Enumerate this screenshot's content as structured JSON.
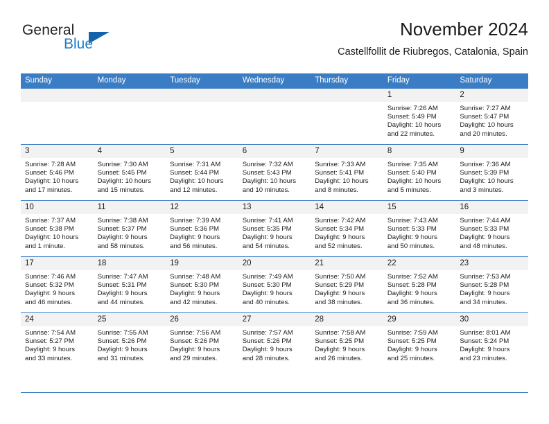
{
  "brand": {
    "name_part1": "General",
    "name_part2": "Blue",
    "triangle_color": "#1164ac",
    "blue_color": "#1d7dc4"
  },
  "header": {
    "title": "November 2024",
    "subtitle": "Castellfollit de Riubregos, Catalonia, Spain"
  },
  "theme": {
    "header_bg": "#3b7dc4",
    "daynum_bg": "#f2f2f2",
    "grid_line": "#3b7dc4"
  },
  "weekday_headers": [
    "Sunday",
    "Monday",
    "Tuesday",
    "Wednesday",
    "Thursday",
    "Friday",
    "Saturday"
  ],
  "weeks": [
    [
      {
        "day": "",
        "sunrise": "",
        "sunset": "",
        "daylight1": "",
        "daylight2": ""
      },
      {
        "day": "",
        "sunrise": "",
        "sunset": "",
        "daylight1": "",
        "daylight2": ""
      },
      {
        "day": "",
        "sunrise": "",
        "sunset": "",
        "daylight1": "",
        "daylight2": ""
      },
      {
        "day": "",
        "sunrise": "",
        "sunset": "",
        "daylight1": "",
        "daylight2": ""
      },
      {
        "day": "",
        "sunrise": "",
        "sunset": "",
        "daylight1": "",
        "daylight2": ""
      },
      {
        "day": "1",
        "sunrise": "Sunrise: 7:26 AM",
        "sunset": "Sunset: 5:49 PM",
        "daylight1": "Daylight: 10 hours",
        "daylight2": "and 22 minutes."
      },
      {
        "day": "2",
        "sunrise": "Sunrise: 7:27 AM",
        "sunset": "Sunset: 5:47 PM",
        "daylight1": "Daylight: 10 hours",
        "daylight2": "and 20 minutes."
      }
    ],
    [
      {
        "day": "3",
        "sunrise": "Sunrise: 7:28 AM",
        "sunset": "Sunset: 5:46 PM",
        "daylight1": "Daylight: 10 hours",
        "daylight2": "and 17 minutes."
      },
      {
        "day": "4",
        "sunrise": "Sunrise: 7:30 AM",
        "sunset": "Sunset: 5:45 PM",
        "daylight1": "Daylight: 10 hours",
        "daylight2": "and 15 minutes."
      },
      {
        "day": "5",
        "sunrise": "Sunrise: 7:31 AM",
        "sunset": "Sunset: 5:44 PM",
        "daylight1": "Daylight: 10 hours",
        "daylight2": "and 12 minutes."
      },
      {
        "day": "6",
        "sunrise": "Sunrise: 7:32 AM",
        "sunset": "Sunset: 5:43 PM",
        "daylight1": "Daylight: 10 hours",
        "daylight2": "and 10 minutes."
      },
      {
        "day": "7",
        "sunrise": "Sunrise: 7:33 AM",
        "sunset": "Sunset: 5:41 PM",
        "daylight1": "Daylight: 10 hours",
        "daylight2": "and 8 minutes."
      },
      {
        "day": "8",
        "sunrise": "Sunrise: 7:35 AM",
        "sunset": "Sunset: 5:40 PM",
        "daylight1": "Daylight: 10 hours",
        "daylight2": "and 5 minutes."
      },
      {
        "day": "9",
        "sunrise": "Sunrise: 7:36 AM",
        "sunset": "Sunset: 5:39 PM",
        "daylight1": "Daylight: 10 hours",
        "daylight2": "and 3 minutes."
      }
    ],
    [
      {
        "day": "10",
        "sunrise": "Sunrise: 7:37 AM",
        "sunset": "Sunset: 5:38 PM",
        "daylight1": "Daylight: 10 hours",
        "daylight2": "and 1 minute."
      },
      {
        "day": "11",
        "sunrise": "Sunrise: 7:38 AM",
        "sunset": "Sunset: 5:37 PM",
        "daylight1": "Daylight: 9 hours",
        "daylight2": "and 58 minutes."
      },
      {
        "day": "12",
        "sunrise": "Sunrise: 7:39 AM",
        "sunset": "Sunset: 5:36 PM",
        "daylight1": "Daylight: 9 hours",
        "daylight2": "and 56 minutes."
      },
      {
        "day": "13",
        "sunrise": "Sunrise: 7:41 AM",
        "sunset": "Sunset: 5:35 PM",
        "daylight1": "Daylight: 9 hours",
        "daylight2": "and 54 minutes."
      },
      {
        "day": "14",
        "sunrise": "Sunrise: 7:42 AM",
        "sunset": "Sunset: 5:34 PM",
        "daylight1": "Daylight: 9 hours",
        "daylight2": "and 52 minutes."
      },
      {
        "day": "15",
        "sunrise": "Sunrise: 7:43 AM",
        "sunset": "Sunset: 5:33 PM",
        "daylight1": "Daylight: 9 hours",
        "daylight2": "and 50 minutes."
      },
      {
        "day": "16",
        "sunrise": "Sunrise: 7:44 AM",
        "sunset": "Sunset: 5:33 PM",
        "daylight1": "Daylight: 9 hours",
        "daylight2": "and 48 minutes."
      }
    ],
    [
      {
        "day": "17",
        "sunrise": "Sunrise: 7:46 AM",
        "sunset": "Sunset: 5:32 PM",
        "daylight1": "Daylight: 9 hours",
        "daylight2": "and 46 minutes."
      },
      {
        "day": "18",
        "sunrise": "Sunrise: 7:47 AM",
        "sunset": "Sunset: 5:31 PM",
        "daylight1": "Daylight: 9 hours",
        "daylight2": "and 44 minutes."
      },
      {
        "day": "19",
        "sunrise": "Sunrise: 7:48 AM",
        "sunset": "Sunset: 5:30 PM",
        "daylight1": "Daylight: 9 hours",
        "daylight2": "and 42 minutes."
      },
      {
        "day": "20",
        "sunrise": "Sunrise: 7:49 AM",
        "sunset": "Sunset: 5:30 PM",
        "daylight1": "Daylight: 9 hours",
        "daylight2": "and 40 minutes."
      },
      {
        "day": "21",
        "sunrise": "Sunrise: 7:50 AM",
        "sunset": "Sunset: 5:29 PM",
        "daylight1": "Daylight: 9 hours",
        "daylight2": "and 38 minutes."
      },
      {
        "day": "22",
        "sunrise": "Sunrise: 7:52 AM",
        "sunset": "Sunset: 5:28 PM",
        "daylight1": "Daylight: 9 hours",
        "daylight2": "and 36 minutes."
      },
      {
        "day": "23",
        "sunrise": "Sunrise: 7:53 AM",
        "sunset": "Sunset: 5:28 PM",
        "daylight1": "Daylight: 9 hours",
        "daylight2": "and 34 minutes."
      }
    ],
    [
      {
        "day": "24",
        "sunrise": "Sunrise: 7:54 AM",
        "sunset": "Sunset: 5:27 PM",
        "daylight1": "Daylight: 9 hours",
        "daylight2": "and 33 minutes."
      },
      {
        "day": "25",
        "sunrise": "Sunrise: 7:55 AM",
        "sunset": "Sunset: 5:26 PM",
        "daylight1": "Daylight: 9 hours",
        "daylight2": "and 31 minutes."
      },
      {
        "day": "26",
        "sunrise": "Sunrise: 7:56 AM",
        "sunset": "Sunset: 5:26 PM",
        "daylight1": "Daylight: 9 hours",
        "daylight2": "and 29 minutes."
      },
      {
        "day": "27",
        "sunrise": "Sunrise: 7:57 AM",
        "sunset": "Sunset: 5:26 PM",
        "daylight1": "Daylight: 9 hours",
        "daylight2": "and 28 minutes."
      },
      {
        "day": "28",
        "sunrise": "Sunrise: 7:58 AM",
        "sunset": "Sunset: 5:25 PM",
        "daylight1": "Daylight: 9 hours",
        "daylight2": "and 26 minutes."
      },
      {
        "day": "29",
        "sunrise": "Sunrise: 7:59 AM",
        "sunset": "Sunset: 5:25 PM",
        "daylight1": "Daylight: 9 hours",
        "daylight2": "and 25 minutes."
      },
      {
        "day": "30",
        "sunrise": "Sunrise: 8:01 AM",
        "sunset": "Sunset: 5:24 PM",
        "daylight1": "Daylight: 9 hours",
        "daylight2": "and 23 minutes."
      }
    ]
  ]
}
